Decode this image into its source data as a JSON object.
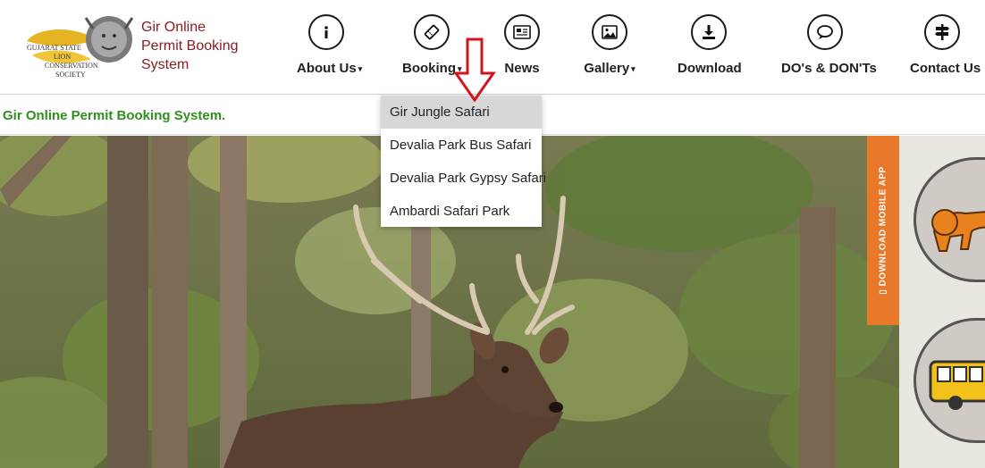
{
  "brand": {
    "logo_text": [
      "GUJARAT STATE",
      "LION",
      "CONSERVATION",
      "SOCIETY"
    ],
    "title_lines": [
      "Gir Online",
      "Permit Booking",
      "System"
    ]
  },
  "nav": [
    {
      "label": "About Us",
      "icon": "info-icon",
      "has_caret": true
    },
    {
      "label": "Booking",
      "icon": "ticket-icon",
      "has_caret": true
    },
    {
      "label": "News",
      "icon": "newspaper-icon",
      "has_caret": false
    },
    {
      "label": "Gallery",
      "icon": "image-icon",
      "has_caret": true
    },
    {
      "label": "Download",
      "icon": "download-icon",
      "has_caret": false
    },
    {
      "label": "DO's & DON'Ts",
      "icon": "chat-icon",
      "has_caret": false
    },
    {
      "label": "Contact Us",
      "icon": "signpost-icon",
      "has_caret": false
    }
  ],
  "caret": "▾",
  "tagline": "Gir Online Permit Booking System.",
  "booking_menu": {
    "items": [
      {
        "label": "Gir Jungle Safari"
      },
      {
        "label": "Devalia Park Bus Safari"
      },
      {
        "label": "Devalia Park Gypsy Safari"
      },
      {
        "label": "Ambardi Safari Park"
      }
    ],
    "highlighted_index": 0
  },
  "app_tab": {
    "label": "▯ DOWNLOAD MOBILE APP"
  },
  "colors": {
    "brand": "#8a1c24",
    "tagline": "#2f8f1d",
    "app_tab": "#e8782a",
    "annotation_arrow": "#d3131b"
  }
}
